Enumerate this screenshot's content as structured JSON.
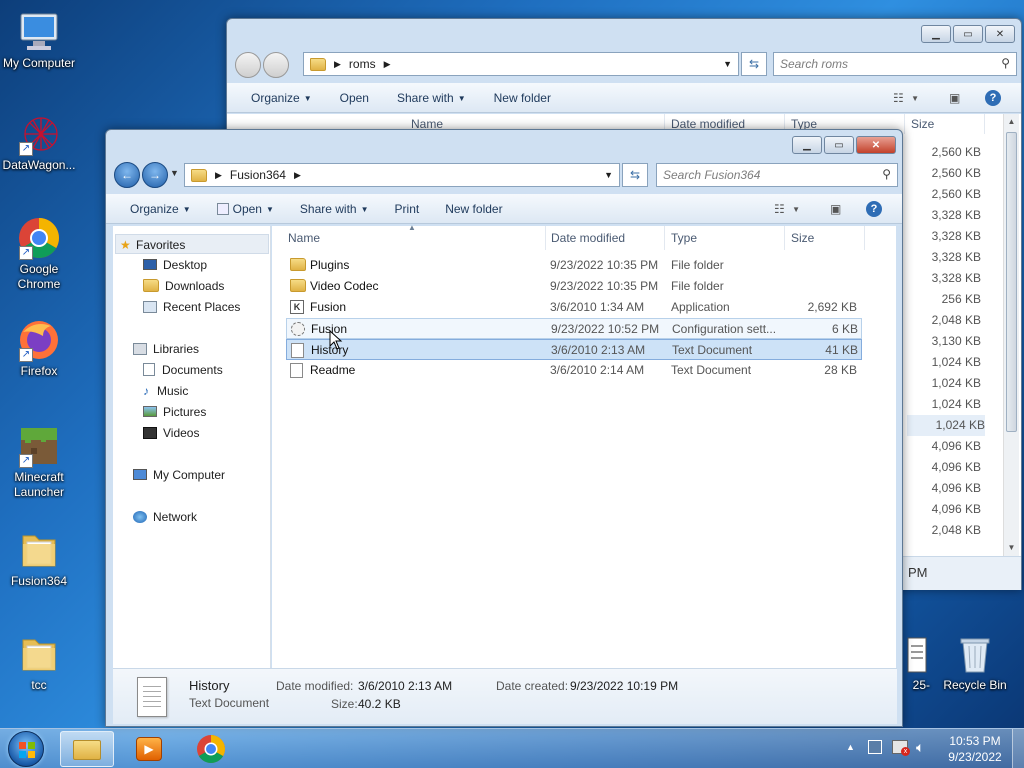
{
  "desktop": {
    "icons": [
      {
        "label": "My Computer"
      },
      {
        "label": "DataWagon..."
      },
      {
        "label": "Google Chrome"
      },
      {
        "label": "Firefox"
      },
      {
        "label": "Minecraft Launcher"
      },
      {
        "label": "Fusion364"
      },
      {
        "label": "tcc"
      },
      {
        "label": "Recycle Bin"
      }
    ],
    "partial_icon_label": "25-"
  },
  "back_window": {
    "path": "roms",
    "search_placeholder": "Search roms",
    "commands": {
      "organize": "Organize",
      "open": "Open",
      "share": "Share with",
      "new_folder": "New folder"
    },
    "columns": {
      "name": "Name",
      "date": "Date modified",
      "type": "Type",
      "size": "Size"
    },
    "sizes": [
      "2,560 KB",
      "2,560 KB",
      "2,560 KB",
      "3,328 KB",
      "3,328 KB",
      "3,328 KB",
      "3,328 KB",
      "256 KB",
      "2,048 KB",
      "3,130 KB",
      "1,024 KB",
      "1,024 KB",
      "1,024 KB",
      "1,024 KB",
      "4,096 KB",
      "4,096 KB",
      "4,096 KB",
      "4,096 KB",
      "2,048 KB"
    ],
    "selected_size_index": 13,
    "partial_text": "PM"
  },
  "front_window": {
    "path": "Fusion364",
    "search_placeholder": "Search Fusion364",
    "commands": {
      "organize": "Organize",
      "open": "Open",
      "share": "Share with",
      "print": "Print",
      "new_folder": "New folder"
    },
    "nav": {
      "favorites": "Favorites",
      "desktop": "Desktop",
      "downloads": "Downloads",
      "recent": "Recent Places",
      "libraries": "Libraries",
      "documents": "Documents",
      "music": "Music",
      "pictures": "Pictures",
      "videos": "Videos",
      "computer": "My Computer",
      "network": "Network"
    },
    "columns": {
      "name": "Name",
      "date": "Date modified",
      "type": "Type",
      "size": "Size"
    },
    "files": [
      {
        "name": "Plugins",
        "date": "9/23/2022 10:35 PM",
        "type": "File folder",
        "size": "",
        "icon": "folder-icon"
      },
      {
        "name": "Video Codec",
        "date": "9/23/2022 10:35 PM",
        "type": "File folder",
        "size": "",
        "icon": "folder-icon"
      },
      {
        "name": "Fusion",
        "date": "3/6/2010 1:34 AM",
        "type": "Application",
        "size": "2,692 KB",
        "icon": "application-icon"
      },
      {
        "name": "Fusion",
        "date": "9/23/2022 10:52 PM",
        "type": "Configuration sett...",
        "size": "6 KB",
        "icon": "config-file-icon"
      },
      {
        "name": "History",
        "date": "3/6/2010 2:13 AM",
        "type": "Text Document",
        "size": "41 KB",
        "icon": "text-file-icon"
      },
      {
        "name": "Readme",
        "date": "3/6/2010 2:14 AM",
        "type": "Text Document",
        "size": "28 KB",
        "icon": "text-file-icon"
      }
    ],
    "details": {
      "name": "History",
      "type": "Text Document",
      "modified_label": "Date modified:",
      "modified": "3/6/2010 2:13 AM",
      "size_label": "Size:",
      "size": "40.2 KB",
      "created_label": "Date created:",
      "created": "9/23/2022 10:19 PM"
    }
  },
  "taskbar": {
    "time": "10:53 PM",
    "date": "9/23/2022"
  }
}
